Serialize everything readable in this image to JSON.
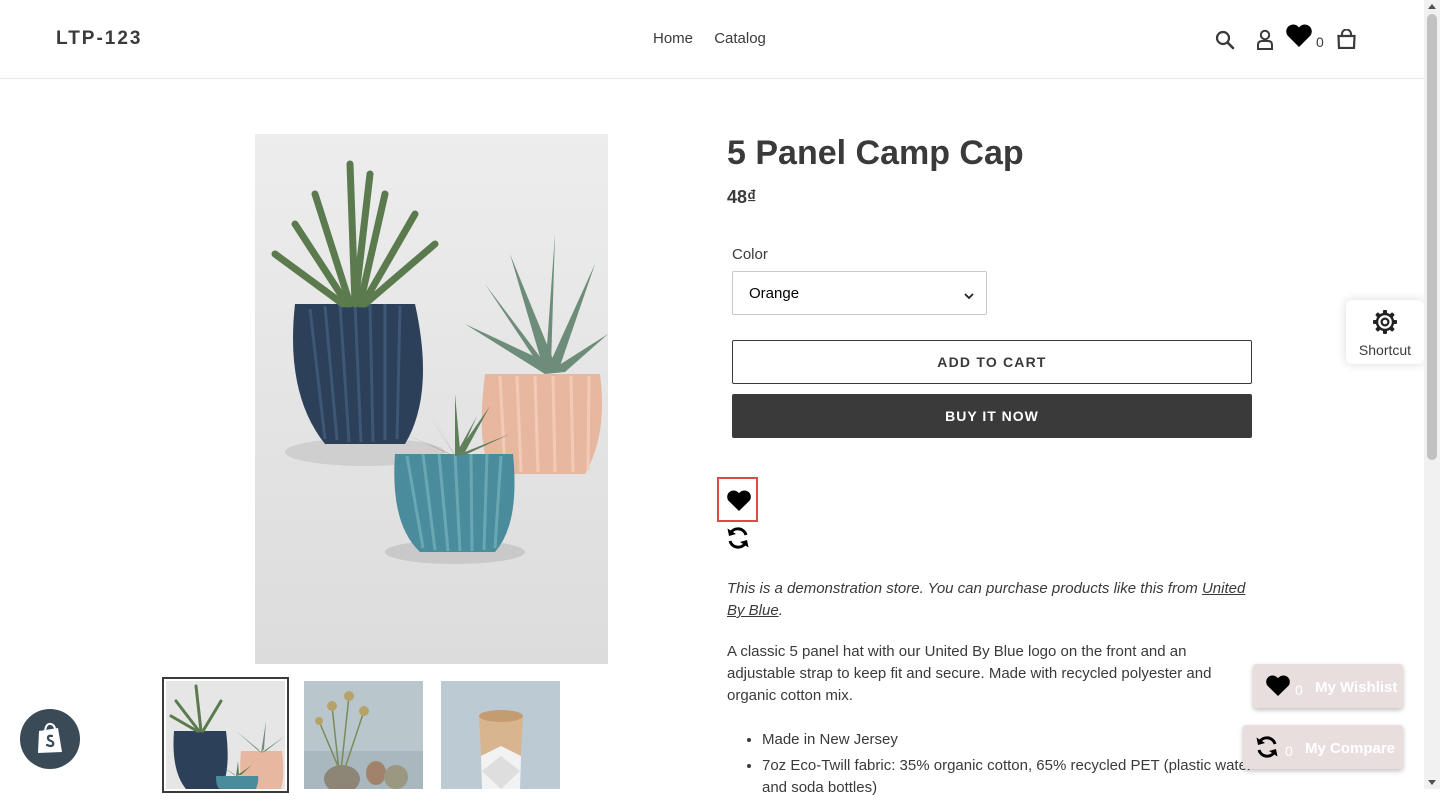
{
  "header": {
    "logo": "LTP-123",
    "nav": [
      {
        "label": "Home"
      },
      {
        "label": "Catalog"
      }
    ],
    "wishlist_count": "0"
  },
  "product": {
    "title": "5 Panel Camp Cap",
    "price": "48₫",
    "color_label": "Color",
    "color_value": "Orange",
    "add_to_cart": "ADD TO CART",
    "buy_now": "BUY IT NOW",
    "note_prefix": "This is a demonstration store. You can purchase products like this from ",
    "note_link": "United By Blue",
    "note_suffix": ".",
    "description": "A classic 5 panel hat with our United By Blue logo on the front and an adjustable strap to keep fit and secure. Made with recycled polyester and organic cotton mix.",
    "features": [
      "Made in New Jersey",
      "7oz Eco-Twill fabric: 35% organic cotton, 65% recycled PET (plastic water and soda bottles)"
    ]
  },
  "widgets": {
    "shortcut_label": "Shortcut",
    "wishlist_count": "0",
    "wishlist_label": "My Wishlist",
    "compare_count": "0",
    "compare_label": "My Compare"
  },
  "colors": {
    "text": "#3a3a3a",
    "buy_button": "#3a3a3a",
    "highlight": "#e04848",
    "float_button": "#e8dedd",
    "shopify_badge": "#3a4a56"
  }
}
